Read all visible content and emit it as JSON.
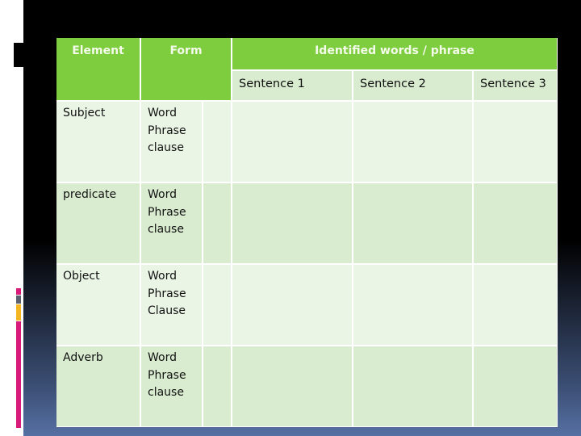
{
  "table": {
    "header": {
      "element": "Element",
      "form": "Form",
      "identified": "Identified words / phrase",
      "sentences": [
        "Sentence 1",
        "Sentence 2",
        "Sentence 3"
      ]
    },
    "rows": [
      {
        "element": "Subject",
        "forms": [
          "Word",
          "Phrase",
          "clause"
        ],
        "sentence1": "",
        "sentence2": "",
        "sentence3": ""
      },
      {
        "element": "predicate",
        "forms": [
          "Word",
          "Phrase",
          "clause"
        ],
        "sentence1": "",
        "sentence2": "",
        "sentence3": ""
      },
      {
        "element": "Object",
        "forms": [
          "Word",
          "Phrase",
          "Clause"
        ],
        "sentence1": "",
        "sentence2": "",
        "sentence3": ""
      },
      {
        "element": "Adverb",
        "forms": [
          "Word",
          "Phrase",
          "clause"
        ],
        "sentence1": "",
        "sentence2": "",
        "sentence3": ""
      }
    ]
  },
  "colors": {
    "header_green": "#7ecd3e",
    "row_light": "#ebf5e6",
    "row_dark": "#d9ecd0",
    "accent_pink": "#d81b7a",
    "accent_gray": "#5a6070",
    "accent_yellow": "#f3b521"
  }
}
